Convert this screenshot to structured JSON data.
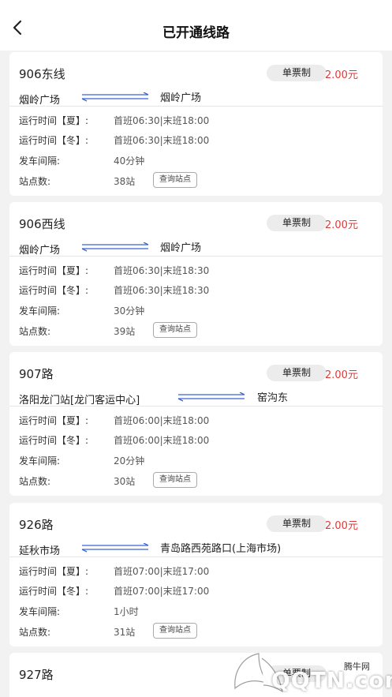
{
  "header": {
    "title": "已开通线路"
  },
  "labels": {
    "summer": "运行时间【夏】:",
    "winter": "运行时间【冬】:",
    "interval": "发车间隔:",
    "stops": "站点数:",
    "query": "查询站点",
    "ticket": "单票制"
  },
  "routes": [
    {
      "name": "906东线",
      "price": "2.00元",
      "from": "烟岭广场",
      "to": "烟岭广场",
      "summer": "首班06:30|末班18:00",
      "winter": "首班06:30|末班18:00",
      "interval": "40分钟",
      "stops": "38站"
    },
    {
      "name": "906西线",
      "price": "2.00元",
      "from": "烟岭广场",
      "to": "烟岭广场",
      "summer": "首班06:30|末班18:30",
      "winter": "首班06:30|末班18:30",
      "interval": "30分钟",
      "stops": "39站"
    },
    {
      "name": "907路",
      "price": "2.00元",
      "from": "洛阳龙门站[龙门客运中心]",
      "to": "窑沟东",
      "summer": "首班06:00|末班18:00",
      "winter": "首班06:00|末班18:00",
      "interval": "20分钟",
      "stops": "30站"
    },
    {
      "name": "926路",
      "price": "2.00元",
      "from": "延秋市场",
      "to": "青岛路西苑路口(上海市场)",
      "summer": "首班07:00|末班17:00",
      "winter": "首班07:00|末班17:00",
      "interval": "1小时",
      "stops": "31站"
    },
    {
      "name": "927路"
    }
  ],
  "watermark": {
    "text": "QQTN.com",
    "small": "腾牛网"
  },
  "colors": {
    "price": "#e03a3a",
    "arrow": "#3b63d8",
    "accent_bg": "#ececec"
  },
  "icons": {
    "back": "chevron-left-icon",
    "arrow": "bidirectional-arrow-icon"
  }
}
